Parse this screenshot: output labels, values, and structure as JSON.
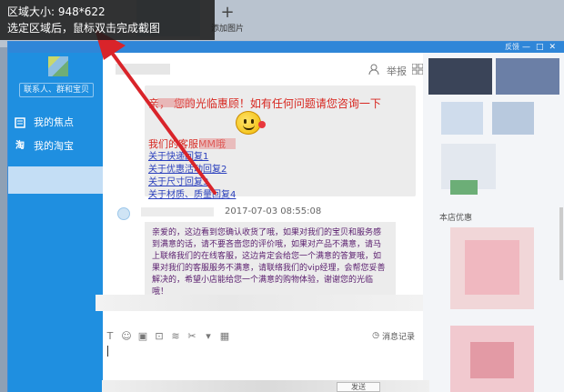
{
  "capture_tooltip": {
    "size_line": "区域大小: 948*622",
    "hint_line": "选定区域后，鼠标双击完成截图"
  },
  "background_toolbar": {
    "add_image_label": "添加图片"
  },
  "window": {
    "feedback_label": "反馈",
    "controls": [
      "—",
      "□",
      "✕"
    ]
  },
  "sidebar": {
    "contact_button": "联系人、群和宝贝",
    "items": [
      {
        "label": "我的焦点",
        "icon": "focus-icon"
      },
      {
        "label": "我的淘宝",
        "icon": "taobao-icon"
      }
    ]
  },
  "chat_header": {
    "report_label": "举报",
    "icons": [
      "add-contact-icon",
      "report-icon",
      "grid-icon"
    ]
  },
  "messages": {
    "greeting": "亲，    您的光临惠顾！如有任何问题请您咨询一下",
    "mm_line": "我们的客服MM哦",
    "links": [
      "关于快递回复1",
      "关于优惠活动回复2",
      "关于尺寸回复3",
      "关于材质、质量回复4"
    ],
    "timestamp": "2017-07-03 08:55:08",
    "reply_text": "亲爱的，这边看到您确认收货了哦，如果对我们的宝贝和服务感到满意的话，请不要吝啬您的评价哦，如果对产品不满意，请马上联络我们的在线客服，这边肯定会给您一个满意的答复哦，如果对我们的客服服务不满意，请联络我们的vip经理，会帮您妥善解决的，希望小店能给您一个满意的购物体验，谢谢您的光临哦！"
  },
  "input_toolbar": {
    "icons": [
      "font-icon",
      "emoji-icon",
      "image-icon",
      "screenshot-icon",
      "shake-icon",
      "cut-icon",
      "more-icon"
    ],
    "history_label": "消息记录",
    "send_label": "发送"
  },
  "right_panel": {
    "shop_promo_label": "本店优惠"
  },
  "colors": {
    "sidebar_blue": "#1f8fe0",
    "title_blue": "#2f86d8",
    "promo_red": "#d7261f",
    "link_blue": "#2a3fbd",
    "arrow_red": "#d9242a"
  }
}
